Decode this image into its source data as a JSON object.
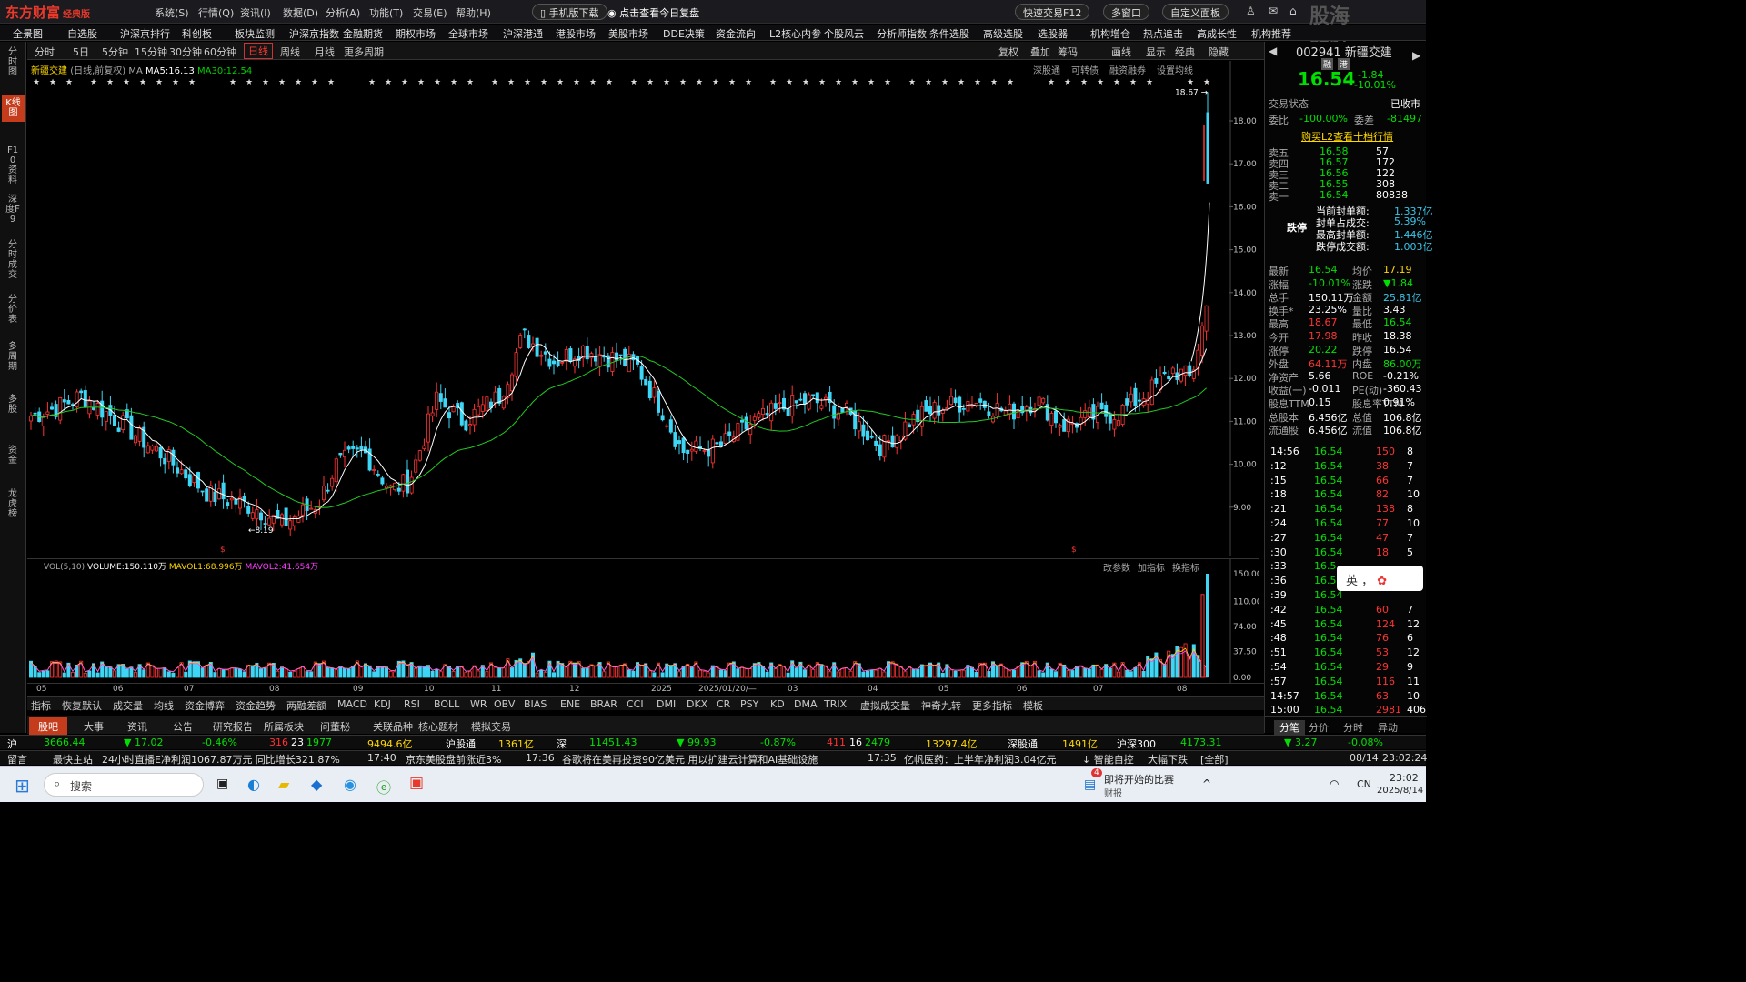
{
  "app": {
    "name": "东方财富",
    "edition": "经典版"
  },
  "menu": [
    "系统(S)",
    "行情(Q)",
    "资讯(I)",
    "数据(D)",
    "分析(A)",
    "功能(T)",
    "交易(E)",
    "帮助(H)"
  ],
  "top_buttons": {
    "mobile": "手机版下载",
    "review": "点击查看今日复盘",
    "fast_trade": "快速交易F12",
    "multi_window": "多窗口",
    "custom_board": "自定义面板"
  },
  "watermark": "股海明灯",
  "nav": [
    "全景图",
    "自选股",
    "沪深京排行",
    "科创板",
    "板块监测",
    "沪深京指数",
    "金融期货",
    "期权市场",
    "全球市场",
    "沪深港通",
    "港股市场",
    "美股市场",
    "DDE决策",
    "资金流向",
    "L2核心内参",
    "个股风云",
    "分析师指数",
    "条件选股",
    "高级选股",
    "选股器",
    "机构增仓",
    "热点追击",
    "高成长性",
    "机构推荐"
  ],
  "left_tabs": [
    "分时图",
    "K线图",
    "F10资料",
    "深度F9",
    "分时成交",
    "分价表",
    "多周期",
    "多股",
    "资金",
    "龙虎榜"
  ],
  "periods": [
    "分时",
    "5日",
    "5分钟",
    "15分钟",
    "30分钟",
    "60分钟",
    "日线",
    "周线",
    "月线",
    "更多周期"
  ],
  "chart_tools": [
    "复权",
    "叠加",
    "筹码",
    "画线",
    "显示",
    "经典",
    "隐藏"
  ],
  "stock": {
    "name": "新疆交建",
    "code": "002941",
    "tag1": "融",
    "tag2": "港",
    "price": "16.54",
    "change": "-1.84",
    "pct": "-10.01%"
  },
  "chart_info": {
    "name": "新疆交建",
    "mode": "(日线,前复权)",
    "ma_label": "MA",
    "ma5": "MA5:16.13",
    "ma30": "MA30:12.54",
    "links": [
      "深股通",
      "可转债",
      "融资融券",
      "设置均线"
    ]
  },
  "chart_annotations": {
    "high": "18.67",
    "low": "8.19"
  },
  "volume_info": {
    "label": "VOL(5,10)",
    "volume": "VOLUME:150.110万",
    "mavol1": "MAVOL1:68.996万",
    "mavol2": "MAVOL2:41.654万",
    "links": [
      "改参数",
      "加指标",
      "换指标"
    ]
  },
  "price_axis": [
    "18.00",
    "17.00",
    "16.00",
    "15.00",
    "14.00",
    "13.00",
    "12.00",
    "11.00",
    "10.00",
    "9.00"
  ],
  "vol_axis": [
    "150.00",
    "110.00",
    "74.00",
    "37.50",
    "0.00"
  ],
  "date_axis": [
    "05",
    "06",
    "07",
    "08",
    "09",
    "10",
    "11",
    "12",
    "2025",
    "2025/01/20/—",
    "03",
    "04",
    "05",
    "06",
    "07",
    "08"
  ],
  "indicators": [
    "指标",
    "恢复默认",
    "成交量",
    "均线",
    "资金博弈",
    "资金趋势",
    "两融差额",
    "MACD",
    "KDJ",
    "RSI",
    "BOLL",
    "WR",
    "OBV",
    "BIAS",
    "ENE",
    "BRAR",
    "CCI",
    "DMI",
    "DKX",
    "CR",
    "PSY",
    "KD",
    "DMA",
    "TRIX",
    "虚拟成交量",
    "神奇九转",
    "更多指标",
    "模板"
  ],
  "bottom_tabs": [
    "股吧",
    "大事",
    "资讯",
    "公告",
    "研究报告",
    "所属板块",
    "问董秘",
    "关联品种",
    "核心题材",
    "模拟交易"
  ],
  "right_panel": {
    "status_label": "交易状态",
    "status_value": "已收市",
    "weibi_label": "委比",
    "weibi": "-100.00%",
    "weicha_label": "委差",
    "weicha": "-81497",
    "l2_link": "购买L2查看十档行情",
    "asks": [
      {
        "l": "卖五",
        "p": "16.58",
        "v": "57"
      },
      {
        "l": "卖四",
        "p": "16.57",
        "v": "172"
      },
      {
        "l": "卖三",
        "p": "16.56",
        "v": "122"
      },
      {
        "l": "卖二",
        "p": "16.55",
        "v": "308"
      },
      {
        "l": "卖一",
        "p": "16.54",
        "v": "80838"
      }
    ],
    "limit_label": "跌停",
    "seal": [
      {
        "l": "当前封单额:",
        "v": "1.337亿"
      },
      {
        "l": "封单占成交:",
        "v": "5.39%"
      },
      {
        "l": "最高封单额:",
        "v": "1.446亿"
      },
      {
        "l": "跌停成交额:",
        "v": "1.003亿"
      }
    ],
    "stats": [
      [
        "最新",
        "16.54",
        "均价",
        "17.19"
      ],
      [
        "涨幅",
        "-10.01%",
        "涨跌",
        "▼1.84"
      ],
      [
        "总手",
        "150.11万",
        "金额",
        "25.81亿"
      ],
      [
        "换手*",
        "23.25%",
        "量比",
        "3.43"
      ],
      [
        "最高",
        "18.67",
        "最低",
        "16.54"
      ],
      [
        "今开",
        "17.98",
        "昨收",
        "18.38"
      ],
      [
        "涨停",
        "20.22",
        "跌停",
        "16.54"
      ],
      [
        "外盘",
        "64.11万",
        "内盘",
        "86.00万"
      ],
      [
        "净资产",
        "5.66",
        "ROE",
        "-0.21%"
      ],
      [
        "收益(一)",
        "-0.011",
        "PE(动)",
        "-360.43"
      ],
      [
        "股息TTM",
        "0.15",
        "股息率TTM",
        "0.91%"
      ],
      [
        "总股本",
        "6.456亿",
        "总值",
        "106.8亿"
      ],
      [
        "流通股",
        "6.456亿",
        "流值",
        "106.8亿"
      ]
    ],
    "ticks": [
      [
        "14:56",
        "16.54",
        "150",
        "8"
      ],
      [
        ":12",
        "16.54",
        "38",
        "7"
      ],
      [
        ":15",
        "16.54",
        "66",
        "7"
      ],
      [
        ":18",
        "16.54",
        "82",
        "10"
      ],
      [
        ":21",
        "16.54",
        "138",
        "8"
      ],
      [
        ":24",
        "16.54",
        "77",
        "10"
      ],
      [
        ":27",
        "16.54",
        "47",
        "7"
      ],
      [
        ":30",
        "16.54",
        "18",
        "5"
      ],
      [
        ":33",
        "16.5",
        "",
        ""
      ],
      [
        ":36",
        "16.5",
        "",
        ""
      ],
      [
        ":39",
        "16.54",
        "",
        ""
      ],
      [
        ":42",
        "16.54",
        "60",
        "7"
      ],
      [
        ":45",
        "16.54",
        "124",
        "12"
      ],
      [
        ":48",
        "16.54",
        "76",
        "6"
      ],
      [
        ":51",
        "16.54",
        "53",
        "12"
      ],
      [
        ":54",
        "16.54",
        "29",
        "9"
      ],
      [
        ":57",
        "16.54",
        "116",
        "11"
      ],
      [
        "14:57",
        "16.54",
        "63",
        "10"
      ],
      [
        "15:00",
        "16.54",
        "2981",
        "406"
      ]
    ],
    "bottom_tabs": [
      "分笔",
      "分价",
      "分时",
      "异动"
    ]
  },
  "status": {
    "sh_label": "沪",
    "sh_index": "3666.44",
    "sh_chg": "▼ 17.02",
    "sh_pct": "-0.46%",
    "sh_ud": "316",
    "sh_eq": "23",
    "sh_dn": "1977",
    "sh_amt": "9494.6亿",
    "hgt": "沪股通",
    "hgt_v": "1361亿",
    "sz_label": "深",
    "sz_index": "11451.43",
    "sz_chg": "▼ 99.93",
    "sz_pct": "-0.87%",
    "sz_ud": "411",
    "sz_eq": "16",
    "sz_dn": "2479",
    "sz_amt": "13297.4亿",
    "sgt": "深股通",
    "sgt_v": "1491亿",
    "hs300": "沪深300",
    "hs300_v": "4173.31",
    "hs300_chg": "▼ 3.27",
    "hs300_pct": "-0.08%"
  },
  "news": {
    "l1": "留言",
    "l2": "最快主站",
    "l3": "24小时直播",
    "n1": "E净利润1067.87万元  同比增长321.87%",
    "t2": "17:40",
    "n2": "京东美股盘前涨近3%",
    "t3": "17:36",
    "n3": "谷歌将在美再投资90亿美元  用以扩建云计算和AI基础设施",
    "t4": "17:35",
    "n4": "亿帆医药：上半年净利润3.04亿元",
    "smart": "↓ 智能自控",
    "smart2": "大幅下跌",
    "all": "[全部]",
    "date": "08/14",
    "time": "23:02:24"
  },
  "taskbar": {
    "search": "搜索",
    "news": "即将开始的比赛",
    "news2": "财报",
    "badge": "4",
    "lang": "CN",
    "time": "23:02",
    "date": "2025/8/14"
  },
  "ime": {
    "label": "英"
  }
}
